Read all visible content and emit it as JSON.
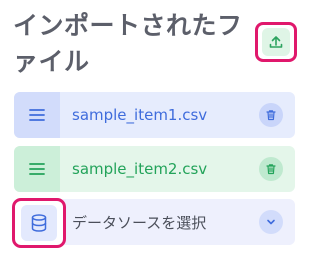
{
  "panel": {
    "title": "インポートされたファイル"
  },
  "files": [
    {
      "name": "sample_item1.csv",
      "color": "#3f6cdc"
    },
    {
      "name": "sample_item2.csv",
      "color": "#23a35a"
    }
  ],
  "datasource": {
    "label": "データソースを選択"
  },
  "icons": {
    "upload": "upload-icon",
    "menu": "menu-icon",
    "trash": "trash-icon",
    "database": "database-icon",
    "chevron": "chevron-down-icon"
  },
  "colors": {
    "highlight": "#e0186c",
    "blue": "#3f6cdc",
    "green": "#23a35a"
  }
}
